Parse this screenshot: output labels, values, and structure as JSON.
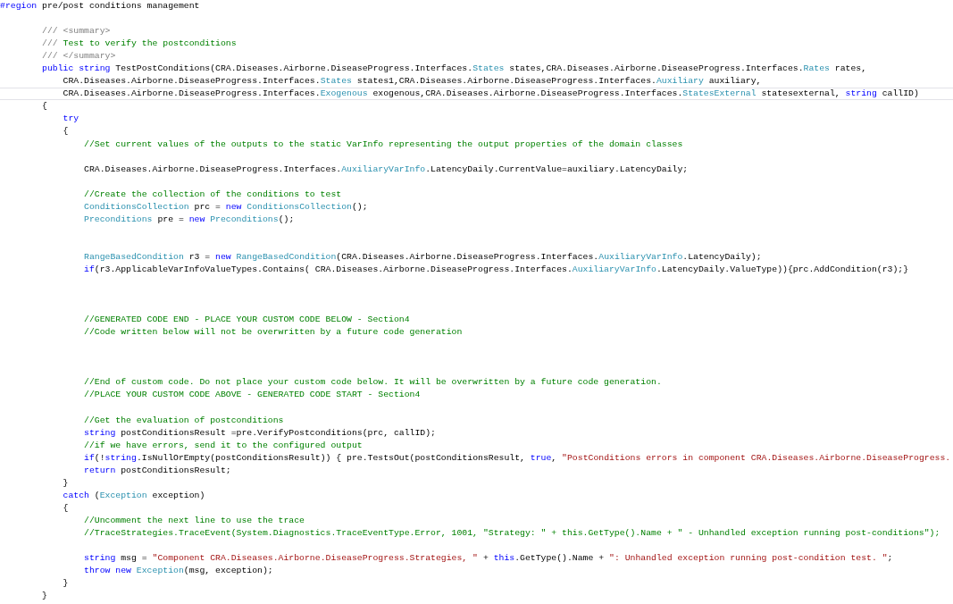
{
  "editor": {
    "lines": [
      {
        "kind": "code",
        "tokens": [
          {
            "kind": "keyword",
            "text": "#region"
          },
          {
            "kind": "plain",
            "text": " pre/post conditions management"
          }
        ]
      },
      {
        "kind": "blank"
      },
      {
        "kind": "code",
        "tokens": [
          {
            "kind": "doc",
            "text": "        /// <summary>"
          }
        ]
      },
      {
        "kind": "code",
        "tokens": [
          {
            "kind": "doc",
            "text": "        /// "
          },
          {
            "kind": "comment",
            "text": "Test to verify the postconditions"
          }
        ]
      },
      {
        "kind": "code",
        "tokens": [
          {
            "kind": "doc",
            "text": "        /// </summary>"
          }
        ]
      },
      {
        "kind": "code",
        "tokens": [
          {
            "kind": "keyword",
            "text": "        public string"
          },
          {
            "kind": "plain",
            "text": " TestPostConditions(CRA.Diseases.Airborne.DiseaseProgress.Interfaces."
          },
          {
            "kind": "type",
            "text": "States"
          },
          {
            "kind": "plain",
            "text": " states,CRA.Diseases.Airborne.DiseaseProgress.Interfaces."
          },
          {
            "kind": "type",
            "text": "Rates"
          },
          {
            "kind": "plain",
            "text": " rates,"
          }
        ]
      },
      {
        "kind": "code",
        "tokens": [
          {
            "kind": "plain",
            "text": "            CRA.Diseases.Airborne.DiseaseProgress.Interfaces."
          },
          {
            "kind": "type",
            "text": "States"
          },
          {
            "kind": "plain",
            "text": " states1,CRA.Diseases.Airborne.DiseaseProgress.Interfaces."
          },
          {
            "kind": "type",
            "text": "Auxiliary"
          },
          {
            "kind": "plain",
            "text": " auxiliary,"
          }
        ]
      },
      {
        "kind": "code",
        "current": true,
        "tokens": [
          {
            "kind": "plain",
            "text": "            CRA.Diseases.Airborne.DiseaseProgress.Interfaces."
          },
          {
            "kind": "type",
            "text": "Exogenous"
          },
          {
            "kind": "plain",
            "text": " exogenous,CRA.Diseases.Airborne.DiseaseProgress.Interfaces."
          },
          {
            "kind": "type",
            "text": "StatesExternal"
          },
          {
            "kind": "plain",
            "text": " statesexternal, "
          },
          {
            "kind": "keyword",
            "text": "string"
          },
          {
            "kind": "plain",
            "text": " callID)"
          }
        ]
      },
      {
        "kind": "code",
        "tokens": [
          {
            "kind": "plain",
            "text": "        {"
          }
        ]
      },
      {
        "kind": "code",
        "tokens": [
          {
            "kind": "keyword",
            "text": "            try"
          }
        ]
      },
      {
        "kind": "code",
        "tokens": [
          {
            "kind": "plain",
            "text": "            {"
          }
        ]
      },
      {
        "kind": "code",
        "tokens": [
          {
            "kind": "comment",
            "text": "                //Set current values of the outputs to the static VarInfo representing the output properties of the domain classes"
          }
        ]
      },
      {
        "kind": "blank"
      },
      {
        "kind": "code",
        "tokens": [
          {
            "kind": "plain",
            "text": "                CRA.Diseases.Airborne.DiseaseProgress.Interfaces."
          },
          {
            "kind": "type",
            "text": "AuxiliaryVarInfo"
          },
          {
            "kind": "plain",
            "text": ".LatencyDaily.CurrentValue=auxiliary.LatencyDaily;"
          }
        ]
      },
      {
        "kind": "blank"
      },
      {
        "kind": "code",
        "tokens": [
          {
            "kind": "comment",
            "text": "                //Create the collection of the conditions to test"
          }
        ]
      },
      {
        "kind": "code",
        "tokens": [
          {
            "kind": "type",
            "text": "                ConditionsCollection"
          },
          {
            "kind": "plain",
            "text": " prc = "
          },
          {
            "kind": "keyword",
            "text": "new "
          },
          {
            "kind": "type",
            "text": "ConditionsCollection"
          },
          {
            "kind": "plain",
            "text": "();"
          }
        ]
      },
      {
        "kind": "code",
        "tokens": [
          {
            "kind": "type",
            "text": "                Preconditions"
          },
          {
            "kind": "plain",
            "text": " pre = "
          },
          {
            "kind": "keyword",
            "text": "new "
          },
          {
            "kind": "type",
            "text": "Preconditions"
          },
          {
            "kind": "plain",
            "text": "();"
          }
        ]
      },
      {
        "kind": "blank"
      },
      {
        "kind": "blank"
      },
      {
        "kind": "code",
        "tokens": [
          {
            "kind": "type",
            "text": "                RangeBasedCondition"
          },
          {
            "kind": "plain",
            "text": " r3 = "
          },
          {
            "kind": "keyword",
            "text": "new "
          },
          {
            "kind": "type",
            "text": "RangeBasedCondition"
          },
          {
            "kind": "plain",
            "text": "(CRA.Diseases.Airborne.DiseaseProgress.Interfaces."
          },
          {
            "kind": "type",
            "text": "AuxiliaryVarInfo"
          },
          {
            "kind": "plain",
            "text": ".LatencyDaily);"
          }
        ]
      },
      {
        "kind": "code",
        "tokens": [
          {
            "kind": "keyword",
            "text": "                if"
          },
          {
            "kind": "plain",
            "text": "(r3.ApplicableVarInfoValueTypes.Contains( CRA.Diseases.Airborne.DiseaseProgress.Interfaces."
          },
          {
            "kind": "type",
            "text": "AuxiliaryVarInfo"
          },
          {
            "kind": "plain",
            "text": ".LatencyDaily.ValueType)){prc.AddCondition(r3);}"
          }
        ]
      },
      {
        "kind": "blank"
      },
      {
        "kind": "blank"
      },
      {
        "kind": "blank"
      },
      {
        "kind": "code",
        "tokens": [
          {
            "kind": "comment",
            "text": "                //GENERATED CODE END - PLACE YOUR CUSTOM CODE BELOW - Section4"
          }
        ]
      },
      {
        "kind": "code",
        "tokens": [
          {
            "kind": "comment",
            "text": "                //Code written below will not be overwritten by a future code generation"
          }
        ]
      },
      {
        "kind": "blank"
      },
      {
        "kind": "blank"
      },
      {
        "kind": "blank"
      },
      {
        "kind": "code",
        "tokens": [
          {
            "kind": "comment",
            "text": "                //End of custom code. Do not place your custom code below. It will be overwritten by a future code generation."
          }
        ]
      },
      {
        "kind": "code",
        "tokens": [
          {
            "kind": "comment",
            "text": "                //PLACE YOUR CUSTOM CODE ABOVE - GENERATED CODE START - Section4"
          }
        ]
      },
      {
        "kind": "blank"
      },
      {
        "kind": "code",
        "tokens": [
          {
            "kind": "comment",
            "text": "                //Get the evaluation of postconditions"
          }
        ]
      },
      {
        "kind": "code",
        "tokens": [
          {
            "kind": "keyword",
            "text": "                string"
          },
          {
            "kind": "plain",
            "text": " postConditionsResult =pre.VerifyPostconditions(prc, callID);"
          }
        ]
      },
      {
        "kind": "code",
        "tokens": [
          {
            "kind": "comment",
            "text": "                //if we have errors, send it to the configured output"
          }
        ]
      },
      {
        "kind": "code",
        "tokens": [
          {
            "kind": "keyword",
            "text": "                if"
          },
          {
            "kind": "plain",
            "text": "(!"
          },
          {
            "kind": "keyword",
            "text": "string"
          },
          {
            "kind": "plain",
            "text": ".IsNullOrEmpty(postConditionsResult)) { pre.TestsOut(postConditionsResult, "
          },
          {
            "kind": "keyword",
            "text": "true"
          },
          {
            "kind": "plain",
            "text": ", "
          },
          {
            "kind": "string",
            "text": "\"PostConditions errors in component CRA.Diseases.Airborne.DiseaseProgress."
          }
        ]
      },
      {
        "kind": "code",
        "tokens": [
          {
            "kind": "keyword",
            "text": "                return"
          },
          {
            "kind": "plain",
            "text": " postConditionsResult;"
          }
        ]
      },
      {
        "kind": "code",
        "tokens": [
          {
            "kind": "plain",
            "text": "            }"
          }
        ]
      },
      {
        "kind": "code",
        "tokens": [
          {
            "kind": "keyword",
            "text": "            catch"
          },
          {
            "kind": "plain",
            "text": " ("
          },
          {
            "kind": "type",
            "text": "Exception"
          },
          {
            "kind": "plain",
            "text": " exception)"
          }
        ]
      },
      {
        "kind": "code",
        "tokens": [
          {
            "kind": "plain",
            "text": "            {"
          }
        ]
      },
      {
        "kind": "code",
        "tokens": [
          {
            "kind": "comment",
            "text": "                //Uncomment the next line to use the trace"
          }
        ]
      },
      {
        "kind": "code",
        "tokens": [
          {
            "kind": "comment",
            "text": "                //TraceStrategies.TraceEvent(System.Diagnostics.TraceEventType.Error, 1001, \"Strategy: \" + this.GetType().Name + \" - Unhandled exception running post-conditions\");"
          }
        ]
      },
      {
        "kind": "blank"
      },
      {
        "kind": "code",
        "tokens": [
          {
            "kind": "keyword",
            "text": "                string"
          },
          {
            "kind": "plain",
            "text": " msg = "
          },
          {
            "kind": "string",
            "text": "\"Component CRA.Diseases.Airborne.DiseaseProgress.Strategies, \""
          },
          {
            "kind": "plain",
            "text": " + "
          },
          {
            "kind": "keyword",
            "text": "this"
          },
          {
            "kind": "plain",
            "text": ".GetType().Name + "
          },
          {
            "kind": "string",
            "text": "\": Unhandled exception running post-condition test. \""
          },
          {
            "kind": "plain",
            "text": ";"
          }
        ]
      },
      {
        "kind": "code",
        "tokens": [
          {
            "kind": "keyword",
            "text": "                throw new "
          },
          {
            "kind": "type",
            "text": "Exception"
          },
          {
            "kind": "plain",
            "text": "(msg, exception);"
          }
        ]
      },
      {
        "kind": "code",
        "tokens": [
          {
            "kind": "plain",
            "text": "            }"
          }
        ]
      },
      {
        "kind": "code",
        "tokens": [
          {
            "kind": "plain",
            "text": "        }"
          }
        ]
      }
    ]
  }
}
